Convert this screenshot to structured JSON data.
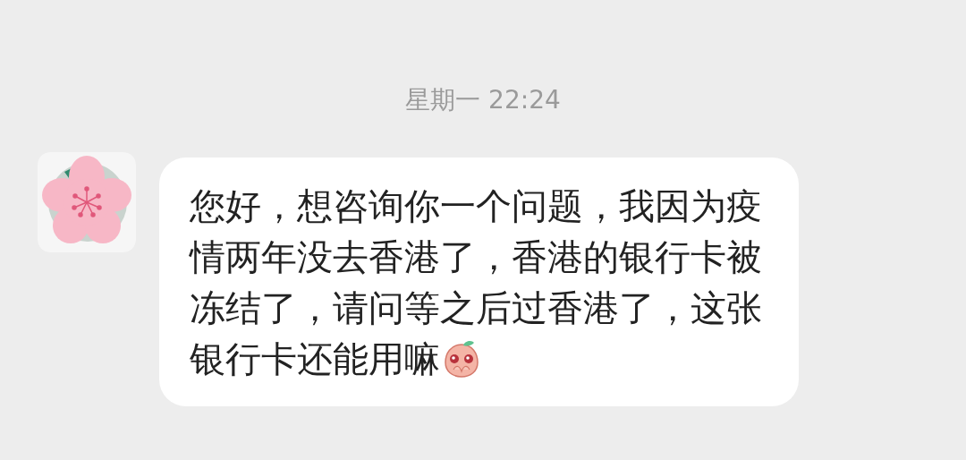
{
  "timestamp": "星期一 22:24",
  "messages": [
    {
      "incoming": true,
      "text": "您好，想咨询你一个问题，我因为疫情两年没去香港了，香港的银行卡被冻结了，请问等之后过香港了，这张银行卡还能用嘛"
    }
  ]
}
